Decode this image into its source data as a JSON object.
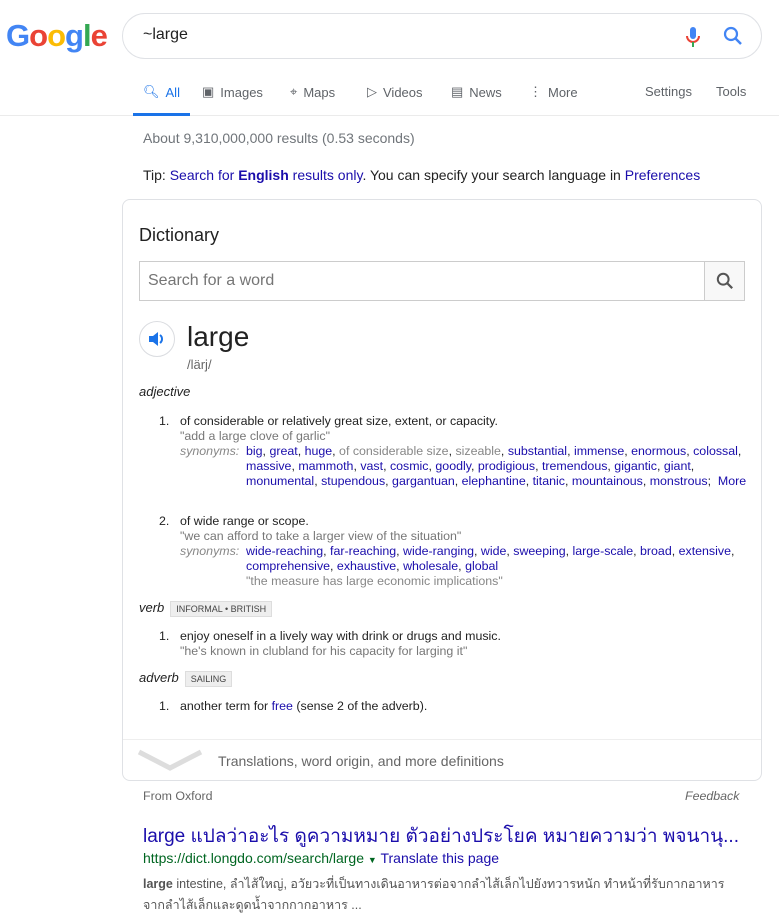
{
  "header": {
    "logo": "Google",
    "query": "~large"
  },
  "tabs": [
    {
      "label": "All",
      "icon": "search-icon"
    },
    {
      "label": "Images",
      "icon": "image-icon"
    },
    {
      "label": "Maps",
      "icon": "map-icon"
    },
    {
      "label": "Videos",
      "icon": "play-icon"
    },
    {
      "label": "News",
      "icon": "news-icon"
    },
    {
      "label": "More",
      "icon": "dots-vertical-icon"
    }
  ],
  "tools": {
    "settings": "Settings",
    "tools": "Tools"
  },
  "stats": "About 9,310,000,000 results (0.53 seconds)",
  "tip": {
    "prefix": "Tip: ",
    "link1a": "Search for ",
    "link1b": "English",
    "link1c": " results only",
    "middle": ". You can specify your search language in ",
    "link2": "Preferences"
  },
  "dictionary": {
    "title": "Dictionary",
    "placeholder": "Search for a word",
    "word": "large",
    "phonetic": "/lärj/",
    "adjective": "adjective",
    "senses_adj": [
      {
        "num": "1.",
        "def": "of considerable or relatively great size, extent, or capacity.",
        "example": "\"add a large clove of garlic\"",
        "syn_label": "synonyms:",
        "synonyms": [
          {
            "t": "big",
            "l": true
          },
          {
            "t": "great",
            "l": true
          },
          {
            "t": "huge",
            "l": true
          },
          {
            "t": "of considerable size",
            "l": false
          },
          {
            "t": "sizeable",
            "l": false
          },
          {
            "t": "substantial",
            "l": true
          },
          {
            "t": "immense",
            "l": true
          },
          {
            "t": "enormous",
            "l": true
          },
          {
            "t": "colossal",
            "l": true
          },
          {
            "t": "massive",
            "l": true
          },
          {
            "t": "mammoth",
            "l": true
          },
          {
            "t": "vast",
            "l": true
          },
          {
            "t": "cosmic",
            "l": true
          },
          {
            "t": "goodly",
            "l": true
          },
          {
            "t": "prodigious",
            "l": true
          },
          {
            "t": "tremendous",
            "l": true
          },
          {
            "t": "gigantic",
            "l": true
          },
          {
            "t": "giant",
            "l": true
          },
          {
            "t": "monumental",
            "l": true
          },
          {
            "t": "stupendous",
            "l": true
          },
          {
            "t": "gargantuan",
            "l": true
          },
          {
            "t": "elephantine",
            "l": true
          },
          {
            "t": "titanic",
            "l": true
          },
          {
            "t": "mountainous",
            "l": true
          },
          {
            "t": "monstrous",
            "l": true
          }
        ],
        "more": "More",
        "syn_example": ""
      },
      {
        "num": "2.",
        "def": "of wide range or scope.",
        "example": "\"we can afford to take a larger view of the situation\"",
        "syn_label": "synonyms:",
        "synonyms": [
          {
            "t": "wide-reaching",
            "l": true
          },
          {
            "t": "far-reaching",
            "l": true
          },
          {
            "t": "wide-ranging",
            "l": true
          },
          {
            "t": "wide",
            "l": true
          },
          {
            "t": "sweeping",
            "l": true
          },
          {
            "t": "large-scale",
            "l": true
          },
          {
            "t": "broad",
            "l": true
          },
          {
            "t": "extensive",
            "l": true
          },
          {
            "t": "comprehensive",
            "l": true
          },
          {
            "t": "exhaustive",
            "l": true
          },
          {
            "t": "wholesale",
            "l": true
          },
          {
            "t": "global",
            "l": true
          }
        ],
        "more": "",
        "syn_example": "\"the measure has large economic implications\""
      }
    ],
    "verb": "verb",
    "verb_badge": "INFORMAL • BRITISH",
    "verb_sense": {
      "num": "1.",
      "def": "enjoy oneself in a lively way with drink or drugs and music.",
      "example": "\"he's known in clubland for his capacity for larging it\""
    },
    "adverb": "adverb",
    "adverb_badge": "SAILING",
    "adverb_sense": {
      "num": "1.",
      "pre": "another term for ",
      "link": "free",
      "post": " (sense 2 of the adverb)."
    },
    "more_defs": "Translations, word origin, and more definitions"
  },
  "source": "From Oxford",
  "feedback": "Feedback",
  "result": {
    "title": "large แปลว่าอะไร ดูความหมาย ตัวอย่างประโยค หมายความว่า พจนานุ...",
    "url": "https://dict.longdo.com/search/large",
    "translate": "Translate this page",
    "snippet_bold": "large",
    "snippet": " intestine, ลำไส้ใหญ่, อวัยวะที่เป็นทางเดินอาหารต่อจากลำไส้เล็กไปยังทวารหนัก ทำหน้าที่รับกากอาหารจากลำไส้เล็กและดูดน้ำจากกากอาหาร ..."
  }
}
